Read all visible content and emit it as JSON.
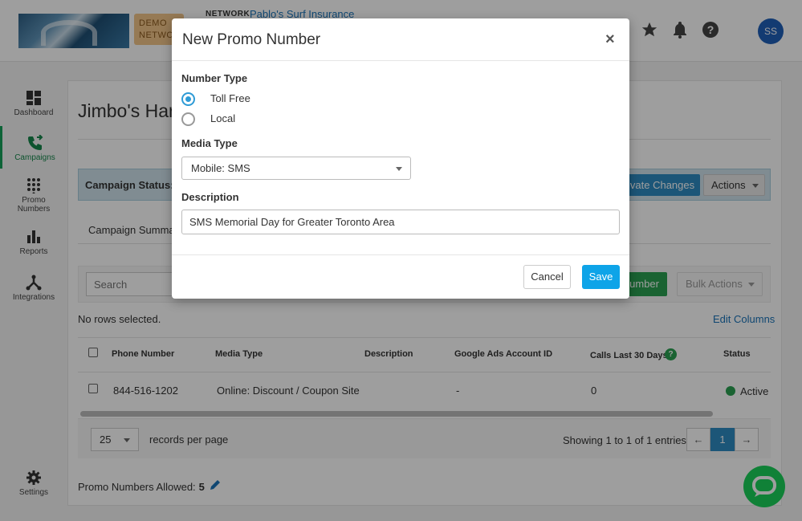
{
  "header": {
    "demo_badge_line1": "DEMO",
    "demo_badge_line2": "NETWO",
    "network_label": "NETWORK",
    "network_name": "Pablo's Surf Insurance",
    "avatar_initials": "SS",
    "icons": [
      "star-icon",
      "bell-icon",
      "help-icon"
    ]
  },
  "sidebar": {
    "items": [
      {
        "label": "Dashboard",
        "icon": "dashboard-icon"
      },
      {
        "label": "Campaigns",
        "icon": "campaigns-icon"
      },
      {
        "label": "Promo",
        "label2": "Numbers",
        "icon": "keypad-icon"
      },
      {
        "label": "Reports",
        "icon": "bar-chart-icon"
      },
      {
        "label": "Integrations",
        "icon": "integrations-icon"
      },
      {
        "label": "Settings",
        "icon": "gear-icon"
      }
    ],
    "active_color": "#15864b"
  },
  "page": {
    "title": "Jimbo's Har",
    "campaign_status": "Campaign Status: Th",
    "activate_label": "ivate Changes",
    "actions_label": "Actions",
    "tab_summary": "Campaign Summar"
  },
  "toolbar": {
    "search_placeholder": "Search",
    "add_label": "umber",
    "bulk_label": "Bulk Actions"
  },
  "table": {
    "no_rows": "No rows selected.",
    "edit_columns": "Edit Columns",
    "headers": [
      "Phone Number",
      "Media Type",
      "Description",
      "Google Ads Account ID",
      "Calls Last 30 Days",
      "Status"
    ],
    "rows": [
      {
        "phone": "844-516-1202",
        "media_type": "Online: Discount / Coupon Site",
        "description": "",
        "google_ads": "-",
        "calls": "0",
        "status": "Active"
      }
    ],
    "status_active_color": "#2aa051"
  },
  "pagination": {
    "per_page": "25",
    "per_page_label": "records per page",
    "showing": "Showing 1 to 1 of 1 entries",
    "prev": "←",
    "current": "1",
    "next": "→"
  },
  "footer": {
    "allowed_label": "Promo Numbers Allowed:",
    "allowed_value": "5"
  },
  "modal": {
    "title": "New Promo Number",
    "close": "×",
    "number_type_label": "Number Type",
    "options": [
      {
        "label": "Toll Free",
        "selected": true
      },
      {
        "label": "Local",
        "selected": false
      }
    ],
    "media_type_label": "Media Type",
    "media_type_value": "Mobile: SMS",
    "description_label": "Description",
    "description_value": "SMS Memorial Day for Greater Toronto Area",
    "cancel_label": "Cancel",
    "save_label": "Save",
    "accent_color": "#0ea4e8"
  }
}
